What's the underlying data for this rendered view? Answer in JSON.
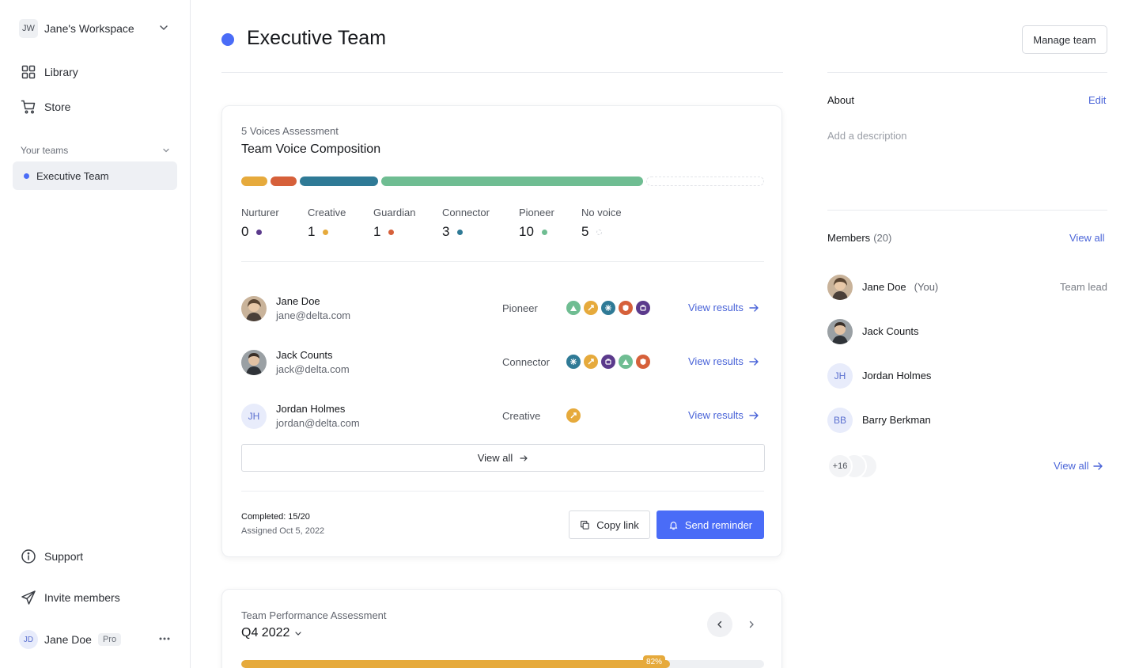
{
  "sidebar": {
    "workspace_initials": "JW",
    "workspace_name": "Jane's Workspace",
    "nav": [
      {
        "label": "Library",
        "icon": "grid-icon"
      },
      {
        "label": "Store",
        "icon": "cart-icon"
      }
    ],
    "teams_header": "Your teams",
    "team_item": "Executive Team",
    "support": "Support",
    "invite": "Invite members",
    "user_initials": "JD",
    "user_name": "Jane Doe",
    "user_badge": "Pro"
  },
  "header": {
    "title": "Executive Team",
    "title_color": "#4a6cf7",
    "manage_button": "Manage team"
  },
  "voices_card": {
    "subtitle": "5 Voices Assessment",
    "title": "Team Voice Composition",
    "voices": [
      {
        "label": "Nurturer",
        "count": "0",
        "color": "#5b3a8c"
      },
      {
        "label": "Creative",
        "count": "1",
        "color": "#e6aa3c"
      },
      {
        "label": "Guardian",
        "count": "1",
        "color": "#d6603a"
      },
      {
        "label": "Connector",
        "count": "3",
        "color": "#2f7a96"
      },
      {
        "label": "Pioneer",
        "count": "10",
        "color": "#6fbd92"
      },
      {
        "label": "No voice",
        "count": "5",
        "color": "#e3e5e9"
      }
    ],
    "members": [
      {
        "name": "Jane Doe",
        "email": "jane@delta.com",
        "voice": "Pioneer",
        "link": "View results"
      },
      {
        "name": "Jack Counts",
        "email": "jack@delta.com",
        "voice": "Connector",
        "link": "View results"
      },
      {
        "name": "Jordan Holmes",
        "initials": "JH",
        "email": "jordan@delta.com",
        "voice": "Creative",
        "link": "View results"
      }
    ],
    "view_all": "View all",
    "completed": "Completed: 15/20",
    "assigned": "Assigned Oct 5, 2022",
    "copy_link": "Copy link",
    "send_reminder": "Send reminder"
  },
  "performance_card": {
    "subtitle": "Team Performance Assessment",
    "period": "Q4 2022",
    "progress": 0.82,
    "progress_label": "82%",
    "progress_color": "#e6aa3c"
  },
  "right": {
    "about_header": "About",
    "edit": "Edit",
    "about_placeholder": "Add a description",
    "members_header": "Members",
    "members_count": "(20)",
    "view_all_top": "View all",
    "members": [
      {
        "name": "Jane Doe",
        "you": "(You)",
        "role": "Team lead"
      },
      {
        "name": "Jack Counts"
      },
      {
        "name": "Jordan Holmes",
        "initials": "JH"
      },
      {
        "name": "Barry Berkman",
        "initials": "BB"
      }
    ],
    "more_count": "+16",
    "view_all_bottom": "View all"
  }
}
